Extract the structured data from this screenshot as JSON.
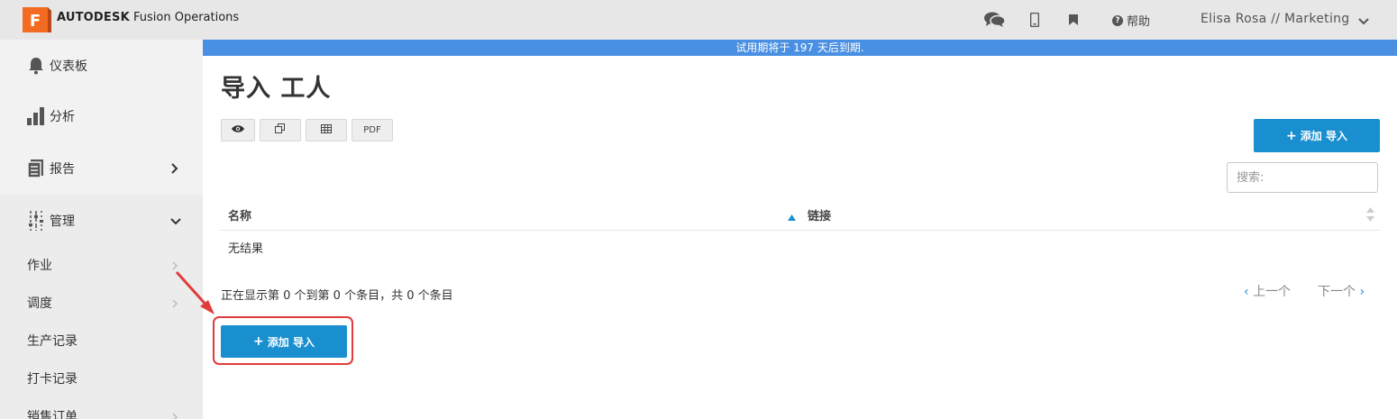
{
  "app": {
    "brand_bold": "AUTODESK",
    "brand_rest": " Fusion Operations",
    "logo_letter": "F",
    "help_label": "帮助",
    "user_label": "Elisa Rosa // Marketing"
  },
  "banner": {
    "text": "试用期将于 197 天后到期."
  },
  "sidebar": {
    "items": [
      {
        "label": "仪表板",
        "icon": "bell-icon"
      },
      {
        "label": "分析",
        "icon": "bar-chart-icon"
      },
      {
        "label": "报告",
        "icon": "report-icon"
      },
      {
        "label": "管理",
        "icon": "sliders-icon"
      }
    ],
    "sub_items": [
      {
        "label": "作业"
      },
      {
        "label": "调度"
      },
      {
        "label": "生产记录"
      },
      {
        "label": "打卡记录"
      },
      {
        "label": "销售订单"
      }
    ]
  },
  "main": {
    "title": "导入 工人",
    "toolbar": {
      "pdf_label": "PDF"
    },
    "add_button_label": "添加 导入",
    "search_placeholder": "搜索:",
    "table": {
      "columns": [
        "名称",
        "链接"
      ],
      "empty_text": "无结果"
    },
    "info_text": "正在显示第 0 个到第 0 个条目，共 0 个条目",
    "pager": {
      "prev": "上一个",
      "next": "下一个"
    }
  },
  "colors": {
    "accent": "#1a8fd0",
    "banner": "#4a90e2",
    "logo": "#f26b21",
    "annotation": "#e23b3b"
  }
}
